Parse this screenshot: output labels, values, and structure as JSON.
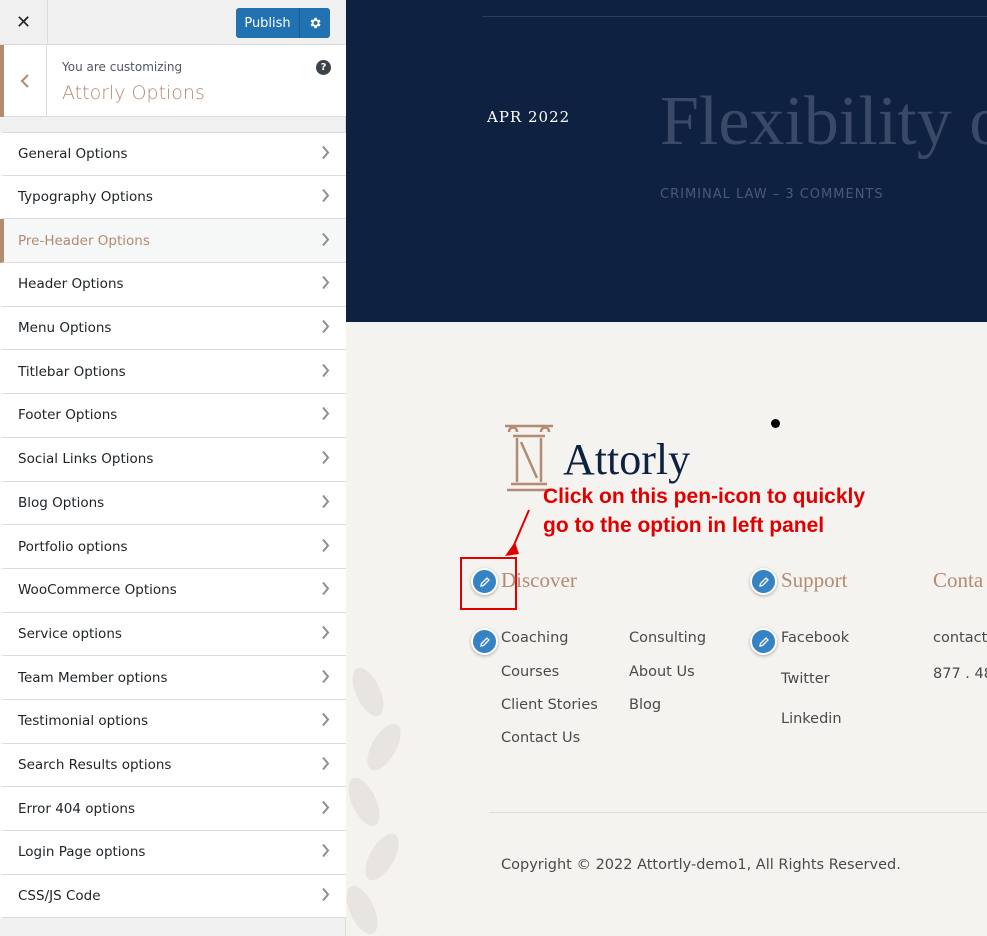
{
  "topbar": {
    "close_label": "✕",
    "publish_label": "Publish"
  },
  "info": {
    "subtitle": "You are customizing",
    "title": "Attorly Options",
    "help": "?"
  },
  "menu": {
    "items": [
      {
        "label": "General Options"
      },
      {
        "label": "Typography Options"
      },
      {
        "label": "Pre-Header Options"
      },
      {
        "label": "Header Options"
      },
      {
        "label": "Menu Options"
      },
      {
        "label": "Titlebar Options"
      },
      {
        "label": "Footer Options"
      },
      {
        "label": "Social Links Options"
      },
      {
        "label": "Blog Options"
      },
      {
        "label": "Portfolio options"
      },
      {
        "label": "WooCommerce Options"
      },
      {
        "label": "Service options"
      },
      {
        "label": "Team Member options"
      },
      {
        "label": "Testimonial options"
      },
      {
        "label": "Search Results options"
      },
      {
        "label": "Error 404 options"
      },
      {
        "label": "Login Page options"
      },
      {
        "label": "CSS/JS Code"
      }
    ],
    "active_index": 2
  },
  "hero": {
    "date": "APR 2022",
    "title": "Flexibility o",
    "meta": "CRIMINAL LAW  –  3 COMMENTS"
  },
  "footer": {
    "logo_text": "Attorly",
    "callout_line1": "Click on this pen-icon to quickly",
    "callout_line2": "go to the option in left panel",
    "discover": {
      "heading": "Discover",
      "col1": [
        "Coaching",
        "Courses",
        "Client Stories",
        "Contact Us"
      ],
      "col2": [
        "Consulting",
        "About Us",
        "Blog"
      ]
    },
    "support": {
      "heading": "Support",
      "links": [
        "Facebook",
        "Twitter",
        "Linkedin"
      ]
    },
    "contact": {
      "heading": "Conta",
      "links": [
        "contact",
        "877 . 48"
      ]
    },
    "copyright": "Copyright © 2022 Attortly-demo1, All Rights Reserved."
  },
  "colors": {
    "accent": "#b38a72",
    "primary_blue": "#2271b1",
    "hero_bg": "#0e2140",
    "annotation_red": "#e00000"
  }
}
